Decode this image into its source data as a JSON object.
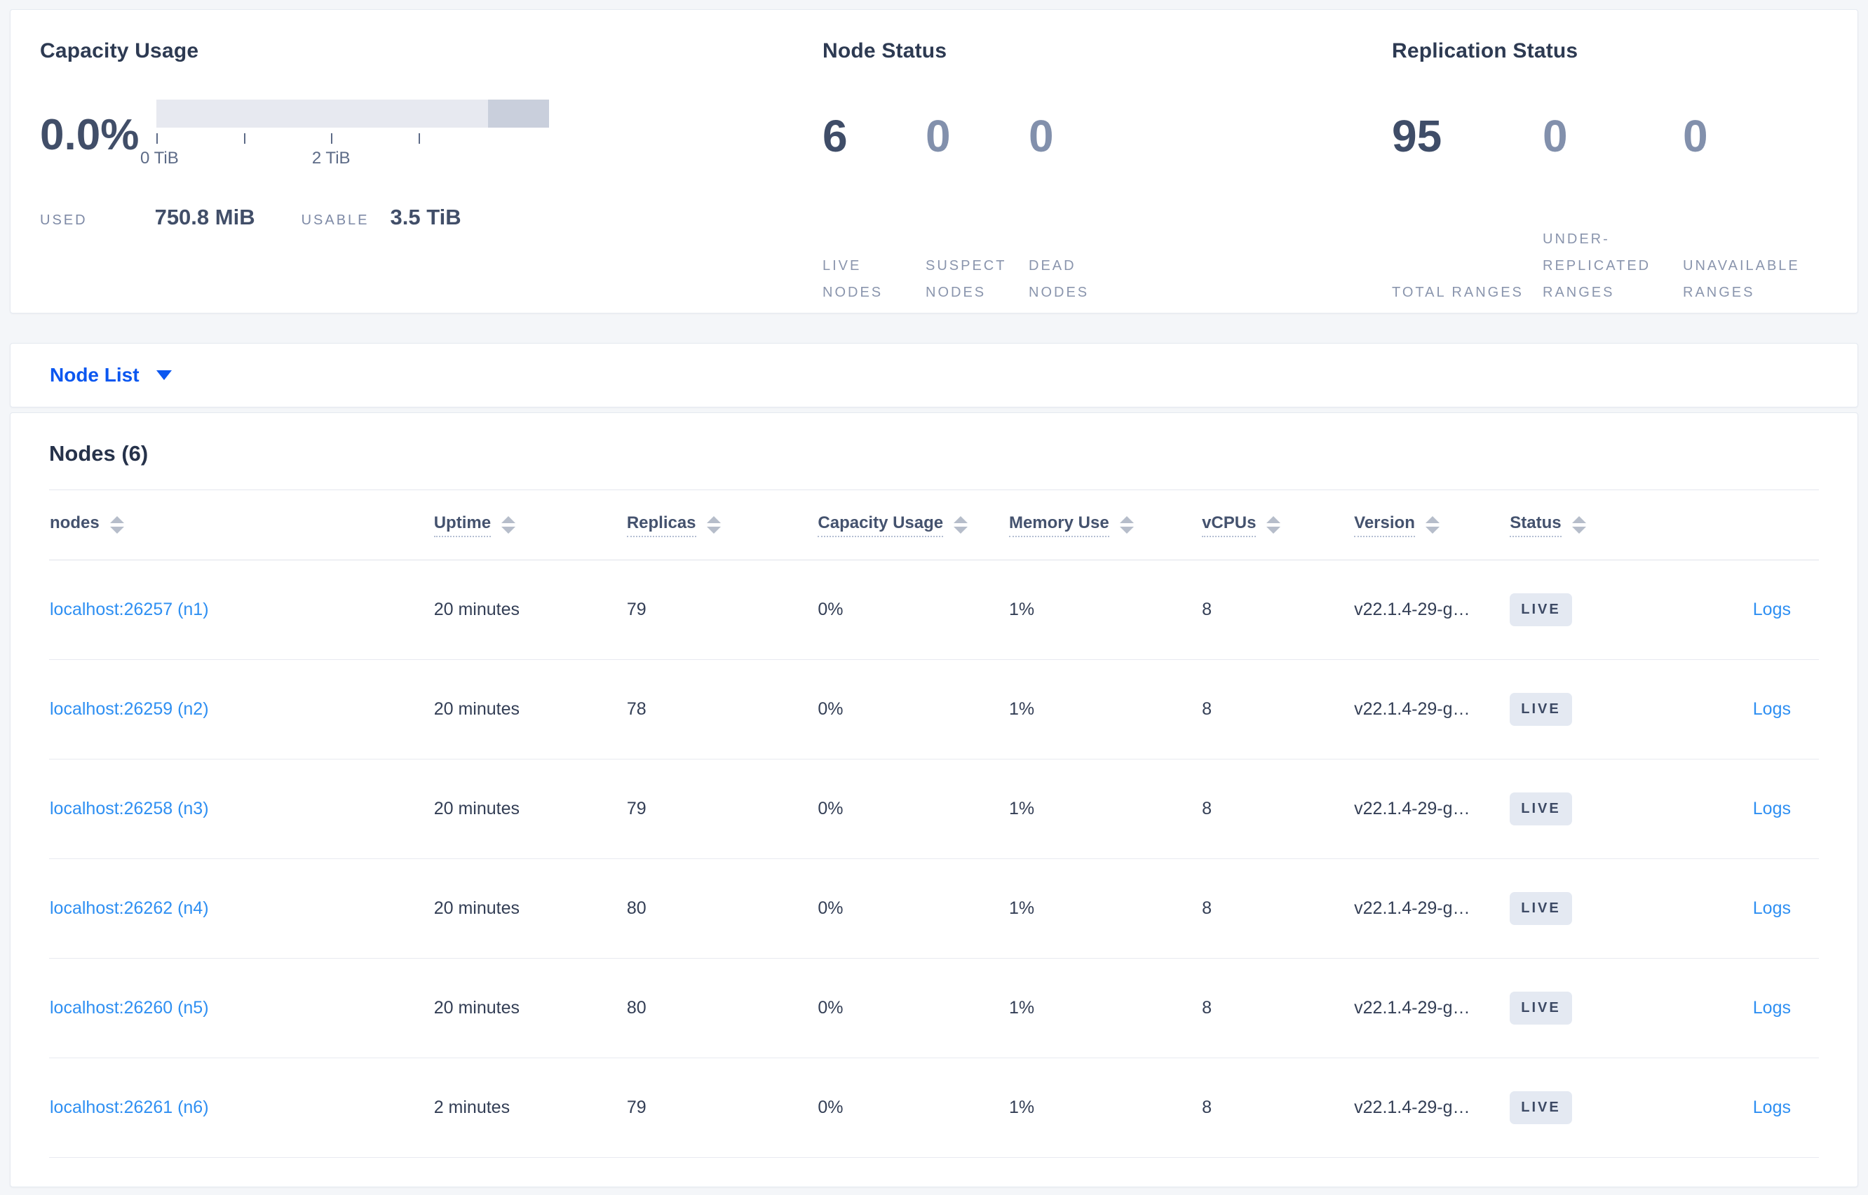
{
  "colors": {
    "primary_blue": "#0b57f0",
    "link_blue": "#2e8ff2",
    "capacity_bar_light": "#e7e9f0",
    "capacity_bar_dark": "#c9cfdc",
    "badge_bg": "#e4e9f2",
    "badge_text": "#3c4964",
    "page_bg": "#f4f6f9"
  },
  "summary": {
    "capacity_usage": {
      "title": "Capacity Usage",
      "percent_used": "0.0%",
      "ticks": [
        {
          "label": "0 TiB",
          "position_pct": 0
        },
        {
          "label": "",
          "position_pct": 22.25
        },
        {
          "label": "2 TiB",
          "position_pct": 44.5
        },
        {
          "label": "",
          "position_pct": 66.75
        }
      ],
      "used_label": "USED",
      "used_value": "750.8 MiB",
      "usable_label": "USABLE",
      "usable_value": "3.5 TiB"
    },
    "node_status": {
      "title": "Node Status",
      "stats": [
        {
          "value": "6",
          "label": "LIVE NODES",
          "emphasis": true
        },
        {
          "value": "0",
          "label": "SUSPECT NODES",
          "emphasis": false
        },
        {
          "value": "0",
          "label": "DEAD NODES",
          "emphasis": false
        }
      ]
    },
    "replication_status": {
      "title": "Replication Status",
      "stats": [
        {
          "value": "95",
          "label": "TOTAL RANGES",
          "emphasis": true
        },
        {
          "value": "0",
          "label": "UNDER-REPLICATED RANGES",
          "emphasis": false
        },
        {
          "value": "0",
          "label": "UNAVAILABLE RANGES",
          "emphasis": false
        }
      ]
    }
  },
  "view_selector": {
    "label": "Node List"
  },
  "nodes_section": {
    "title": "Nodes (6)",
    "columns": [
      {
        "label": "nodes",
        "has_tooltip": false
      },
      {
        "label": "Uptime",
        "has_tooltip": true
      },
      {
        "label": "Replicas",
        "has_tooltip": true
      },
      {
        "label": "Capacity Usage",
        "has_tooltip": true
      },
      {
        "label": "Memory Use",
        "has_tooltip": true
      },
      {
        "label": "vCPUs",
        "has_tooltip": true
      },
      {
        "label": "Version",
        "has_tooltip": true
      },
      {
        "label": "Status",
        "has_tooltip": true
      }
    ],
    "rows": [
      {
        "node": "localhost:26257 (n1)",
        "uptime": "20 minutes",
        "replicas": "79",
        "capacity_usage": "0%",
        "memory_use": "1%",
        "vcpus": "8",
        "version": "v22.1.4-29-g…",
        "status": "LIVE",
        "logs": "Logs"
      },
      {
        "node": "localhost:26259 (n2)",
        "uptime": "20 minutes",
        "replicas": "78",
        "capacity_usage": "0%",
        "memory_use": "1%",
        "vcpus": "8",
        "version": "v22.1.4-29-g…",
        "status": "LIVE",
        "logs": "Logs"
      },
      {
        "node": "localhost:26258 (n3)",
        "uptime": "20 minutes",
        "replicas": "79",
        "capacity_usage": "0%",
        "memory_use": "1%",
        "vcpus": "8",
        "version": "v22.1.4-29-g…",
        "status": "LIVE",
        "logs": "Logs"
      },
      {
        "node": "localhost:26262 (n4)",
        "uptime": "20 minutes",
        "replicas": "80",
        "capacity_usage": "0%",
        "memory_use": "1%",
        "vcpus": "8",
        "version": "v22.1.4-29-g…",
        "status": "LIVE",
        "logs": "Logs"
      },
      {
        "node": "localhost:26260 (n5)",
        "uptime": "20 minutes",
        "replicas": "80",
        "capacity_usage": "0%",
        "memory_use": "1%",
        "vcpus": "8",
        "version": "v22.1.4-29-g…",
        "status": "LIVE",
        "logs": "Logs"
      },
      {
        "node": "localhost:26261 (n6)",
        "uptime": "2 minutes",
        "replicas": "79",
        "capacity_usage": "0%",
        "memory_use": "1%",
        "vcpus": "8",
        "version": "v22.1.4-29-g…",
        "status": "LIVE",
        "logs": "Logs"
      }
    ]
  }
}
